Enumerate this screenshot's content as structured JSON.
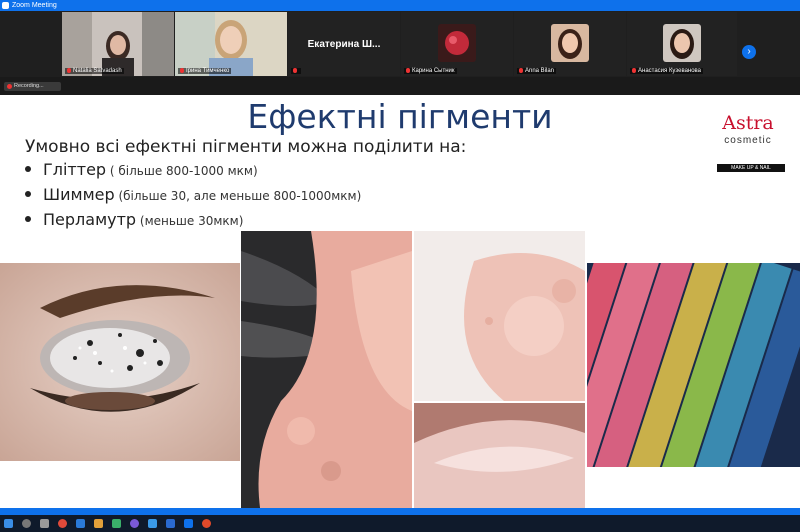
{
  "window": {
    "title": "Zoom Meeting"
  },
  "participants": [
    {
      "name": "Natalia Satvadash"
    },
    {
      "name": "Ірина Тимченко"
    },
    {
      "name": "Екатерина  Ш..."
    },
    {
      "name": "Карина Сытник"
    },
    {
      "name": "Anna Bilan"
    },
    {
      "name": "Анастасия Кузеванова"
    }
  ],
  "recording_label": "Recording...",
  "slide": {
    "title": "Ефектні пігменти",
    "intro": "Умовно всі ефектні пігменти можна поділити на:",
    "bullets": [
      {
        "term": "Гліттер",
        "note": " ( більше 800-1000 мкм)"
      },
      {
        "term": "Шиммер",
        "note": " (більше 30, але меньше 800-1000мкм)"
      },
      {
        "term": "Перламутр",
        "note": " (меньше 30мкм)"
      }
    ]
  },
  "logo": {
    "brand": "Astra",
    "sub": "cosmetic",
    "tagline": "MAKE UP & NAIL"
  },
  "colors": {
    "accent": "#0e71eb",
    "title": "#1f3b6e",
    "brand": "#c8102e"
  },
  "icons": [
    "zoom-icon",
    "mic-muted-icon",
    "chevron-right-icon",
    "record-dot-icon"
  ]
}
